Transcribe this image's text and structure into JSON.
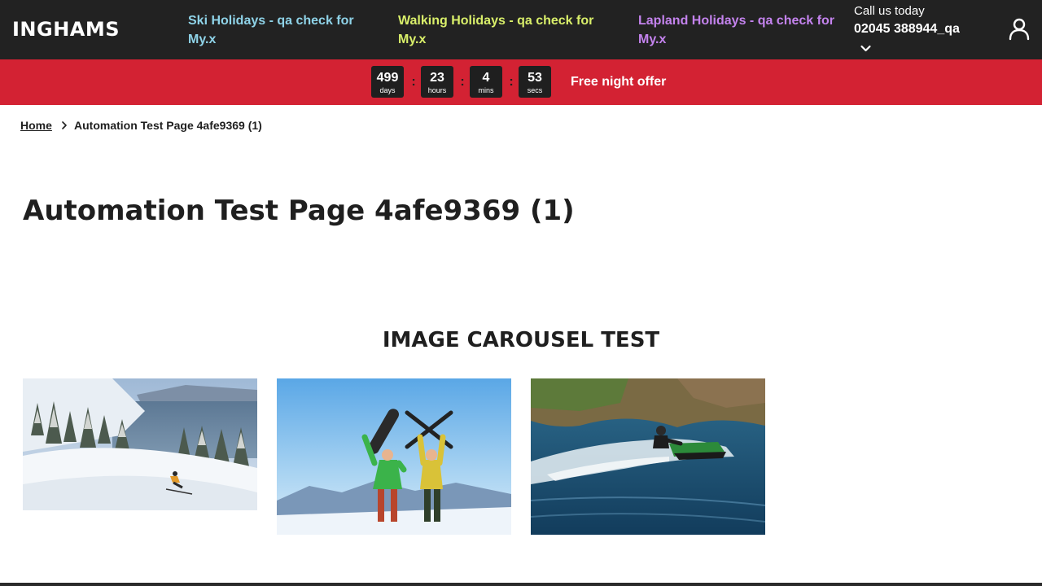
{
  "header": {
    "logo": "INGHAMS",
    "nav": {
      "ski": "Ski Holidays - qa check for My.x",
      "walking": "Walking Holidays - qa check for My.x",
      "lapland": "Lapland Holidays - qa check for My.x"
    },
    "call": {
      "label": "Call us today",
      "number": "02045 388944_qa"
    },
    "icons": [
      "chevron-down-icon",
      "user-icon"
    ]
  },
  "promo": {
    "countdown": [
      {
        "value": "499",
        "unit": "days"
      },
      {
        "value": "23",
        "unit": "hours"
      },
      {
        "value": "4",
        "unit": "mins"
      },
      {
        "value": "53",
        "unit": "secs"
      }
    ],
    "separator": ":",
    "offer": "Free night offer",
    "background_color": "#d32233"
  },
  "breadcrumb": {
    "home": "Home",
    "current": "Automation Test Page 4afe9369 (1)"
  },
  "page": {
    "title": "Automation Test Page 4afe9369 (1)"
  },
  "carousel": {
    "title": "IMAGE CAROUSEL TEST",
    "items": [
      {
        "image": "skier-on-snowy-slope"
      },
      {
        "image": "two-people-holding-snowboard-and-skis"
      },
      {
        "image": "jet-ski-on-water"
      }
    ]
  },
  "colors": {
    "nav_background": "#222222",
    "ski_link": "#8fd3e8",
    "walking_link": "#d9ef6a",
    "lapland_link": "#c483ee",
    "promo_red": "#d32233",
    "countdown_box": "#1f1f1f"
  }
}
